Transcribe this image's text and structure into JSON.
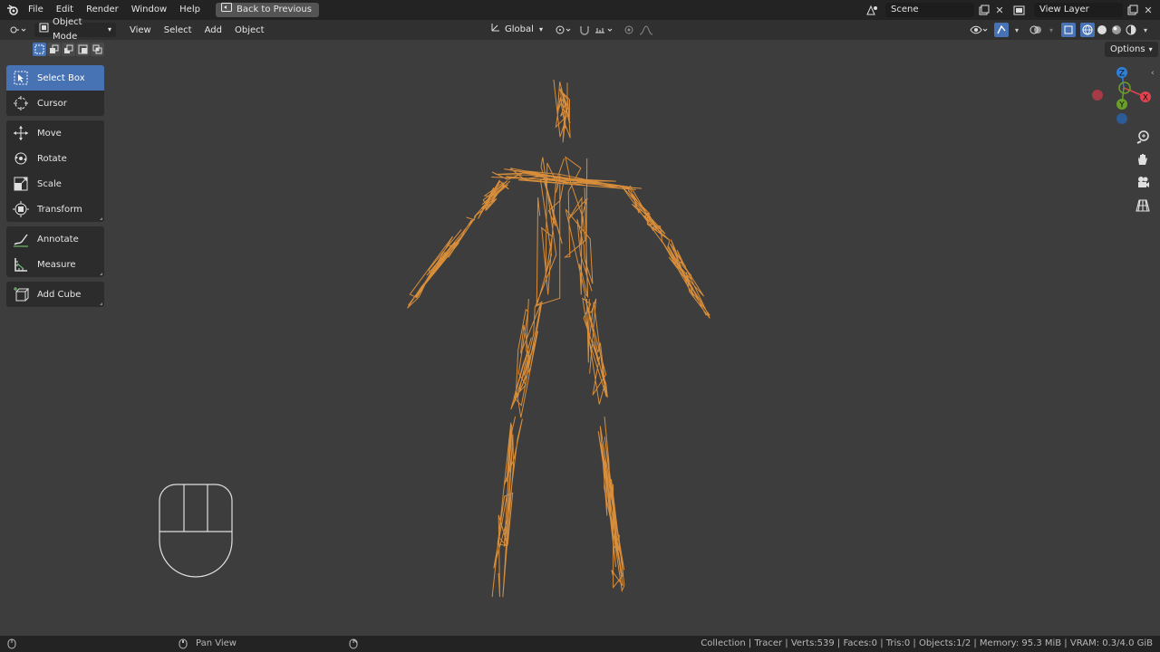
{
  "topbar": {
    "menus": [
      "File",
      "Edit",
      "Render",
      "Window",
      "Help"
    ],
    "back_label": "Back to Previous",
    "scene_value": "Scene",
    "view_layer_value": "View Layer"
  },
  "viewport_header": {
    "mode_label": "Object Mode",
    "menus": [
      "View",
      "Select",
      "Add",
      "Object"
    ],
    "orientation_label": "Global",
    "options_label": "Options"
  },
  "toolbar": {
    "groups": [
      [
        {
          "label": "Select Box",
          "icon": "select-box-icon",
          "active": true
        },
        {
          "label": "Cursor",
          "icon": "cursor-icon"
        }
      ],
      [
        {
          "label": "Move",
          "icon": "move-icon"
        },
        {
          "label": "Rotate",
          "icon": "rotate-icon"
        },
        {
          "label": "Scale",
          "icon": "scale-icon"
        },
        {
          "label": "Transform",
          "icon": "transform-icon"
        }
      ],
      [
        {
          "label": "Annotate",
          "icon": "annotate-icon"
        },
        {
          "label": "Measure",
          "icon": "measure-icon"
        }
      ],
      [
        {
          "label": "Add Cube",
          "icon": "add-cube-icon"
        }
      ]
    ]
  },
  "gizmo": {
    "z_label": "Z",
    "y_label": "Y",
    "x_label": "X"
  },
  "status": {
    "pan_label": "Pan View",
    "info": "Collection | Tracer | Verts:539 | Faces:0 | Tris:0 | Objects:1/2 | Memory: 95.3 MiB | VRAM: 0.3/4.0 GiB"
  },
  "colors": {
    "accent": "#4772b3",
    "wire": "#e0913a",
    "axis_x": "#e0424f",
    "axis_y": "#6a9f2a",
    "axis_z": "#2f7fd8"
  }
}
